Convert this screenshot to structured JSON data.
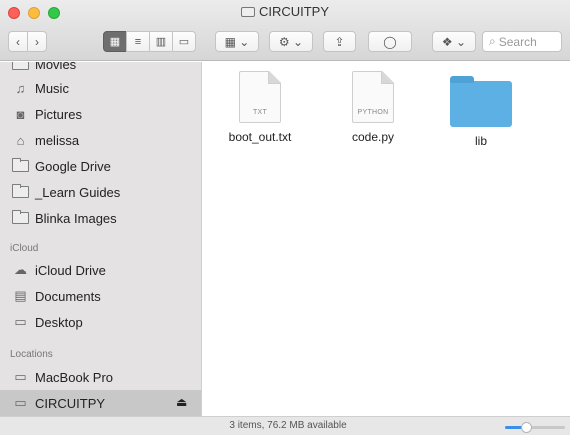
{
  "window": {
    "title": "CIRCUITPY"
  },
  "toolbar": {
    "back_icon": "chevron-left-icon",
    "back_glyph": "‹",
    "forward_icon": "chevron-right-icon",
    "forward_glyph": "›",
    "view_modes": [
      {
        "name": "icon-view",
        "glyph": "▦"
      },
      {
        "name": "list-view",
        "glyph": "≡"
      },
      {
        "name": "column-view",
        "glyph": "▥"
      },
      {
        "name": "gallery-view",
        "glyph": "▭"
      }
    ],
    "arrange_glyph": "▦ ⌄",
    "action_glyph": "⚙ ⌄",
    "share_glyph": "⇪",
    "tags_glyph": "◯",
    "dropbox_glyph": "❖ ⌄",
    "search_placeholder": "Search",
    "search_glyph": "⌕"
  },
  "sidebar": {
    "top_items": [
      {
        "label": "Movies",
        "icon": "movies-icon"
      },
      {
        "label": "Music",
        "icon": "music-icon"
      },
      {
        "label": "Pictures",
        "icon": "camera-icon"
      },
      {
        "label": "melissa",
        "icon": "home-icon"
      },
      {
        "label": "Google Drive",
        "icon": "folder-icon"
      },
      {
        "label": "_Learn Guides",
        "icon": "folder-icon"
      },
      {
        "label": "Blinka Images",
        "icon": "folder-icon"
      }
    ],
    "icloud_header": "iCloud",
    "icloud_items": [
      {
        "label": "iCloud Drive",
        "icon": "cloud-icon"
      },
      {
        "label": "Documents",
        "icon": "documents-icon"
      },
      {
        "label": "Desktop",
        "icon": "desktop-icon"
      }
    ],
    "locations_header": "Locations",
    "location_items": [
      {
        "label": "MacBook Pro",
        "icon": "laptop-icon"
      },
      {
        "label": "CIRCUITPY",
        "icon": "disk-icon",
        "selected": true
      }
    ],
    "eject_glyph": "⏏"
  },
  "files": [
    {
      "name": "boot_out.txt",
      "kind": "document",
      "ext": "TXT"
    },
    {
      "name": "code.py",
      "kind": "document",
      "ext": "PYTHON"
    },
    {
      "name": "lib",
      "kind": "folder",
      "ext": ""
    }
  ],
  "status": {
    "text": "3 items, 76.2 MB available",
    "icon_size_fraction": 0.35
  },
  "colors": {
    "folder_blue": "#5db0e3",
    "accent": "#3b8fe8",
    "sidebar_bg": "#e4e2e3"
  }
}
